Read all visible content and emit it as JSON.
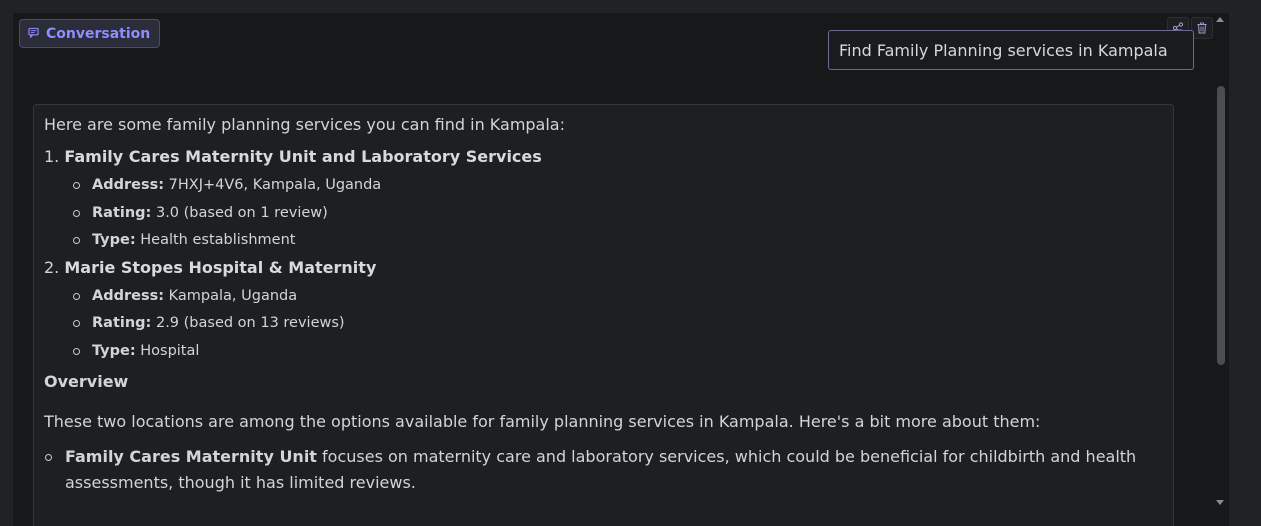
{
  "conversation_badge": {
    "label": "Conversation",
    "icon": "message-icon"
  },
  "actions": [
    {
      "icon": "share-icon"
    },
    {
      "icon": "trash-icon"
    }
  ],
  "user_message": "Find Family Planning services in Kampala",
  "assistant": {
    "intro": "Here are some family planning services you can find in Kampala:",
    "items": [
      {
        "number": "1.",
        "name": "Family Cares Maternity Unit and Laboratory Services",
        "details": [
          {
            "label": "Address:",
            "value": "7HXJ+4V6, Kampala, Uganda"
          },
          {
            "label": "Rating:",
            "value": "3.0 (based on 1 review)"
          },
          {
            "label": "Type:",
            "value": "Health establishment"
          }
        ]
      },
      {
        "number": "2.",
        "name": "Marie Stopes Hospital & Maternity",
        "details": [
          {
            "label": "Address:",
            "value": "Kampala, Uganda"
          },
          {
            "label": "Rating:",
            "value": "2.9 (based on 13 reviews)"
          },
          {
            "label": "Type:",
            "value": "Hospital"
          }
        ]
      }
    ],
    "overview_heading": "Overview",
    "overview_text": "These two locations are among the options available for family planning services in Kampala. Here's a bit more about them:",
    "bullet": {
      "bold": "Family Cares Maternity Unit",
      "text": " focuses on maternity care and laboratory services, which could be beneficial for childbirth and health assessments, though it has limited reviews."
    }
  },
  "colors": {
    "accent": "#8f8dff",
    "background": "#17181a",
    "text": "#d3d4d8"
  }
}
